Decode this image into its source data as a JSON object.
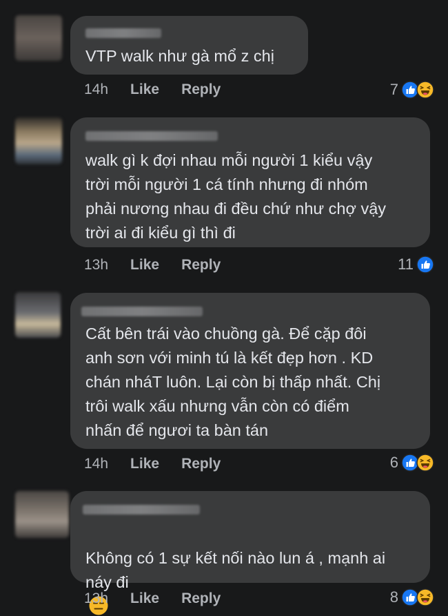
{
  "colors": {
    "background": "#18191a",
    "bubble": "#3a3b3c",
    "text": "#e4e6eb",
    "meta": "#b0b3b8",
    "like_blue": "#1877f2",
    "haha_yellow": "#f7b928"
  },
  "comments": [
    {
      "text": "VTP walk như gà mổ z chị",
      "time": "14h",
      "like_label": "Like",
      "reply_label": "Reply",
      "reaction_count": "7",
      "reactions": [
        "like-icon",
        "haha-icon"
      ]
    },
    {
      "text": "walk gì k đợi nhau mỗi người 1 kiểu vậy\ntrời mỗi người 1 cá tính nhưng đi nhóm\nphải nương nhau đi đều chứ như chợ vậy\ntrời ai đi kiểu gì thì đi",
      "time": "13h",
      "like_label": "Like",
      "reply_label": "Reply",
      "reaction_count": "11",
      "reactions": [
        "like-icon"
      ]
    },
    {
      "text": "Cất bên trái vào chuồng gà. Để cặp đôi\nanh sơn với minh tú là kết đẹp hơn . KD\nchán nháT luôn. Lại còn bị thấp nhất. Chị\ntrôi walk xấu nhưng vẫn còn có điểm\nnhấn để ngươi ta bàn tán",
      "time": "14h",
      "like_label": "Like",
      "reply_label": "Reply",
      "reaction_count": "6",
      "reactions": [
        "like-icon",
        "haha-icon"
      ]
    },
    {
      "text": "Không có 1 sự kết nối nào lun á , mạnh ai\nnáy đi",
      "inline_emoji": "expressionless-face-icon",
      "time": "13h",
      "like_label": "Like",
      "reply_label": "Reply",
      "reaction_count": "8",
      "reactions": [
        "like-icon",
        "haha-icon"
      ]
    }
  ]
}
